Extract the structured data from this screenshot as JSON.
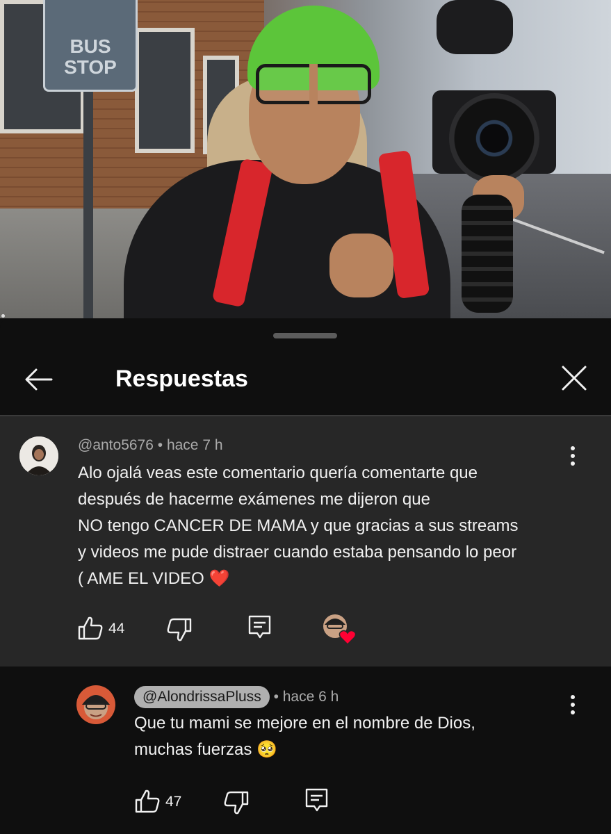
{
  "video": {
    "sign_text_line1": "BUS",
    "sign_text_line2": "STOP"
  },
  "panel": {
    "title": "Respuestas"
  },
  "comment": {
    "author": "@anto5676",
    "time": "hace 7 h",
    "text_lines": [
      "Alo ojalá veas este comentario quería comentarte que",
      "después de hacerme exámenes me dijeron que",
      "NO tengo CANCER DE MAMA y que gracias a sus streams",
      "y videos me pude distraer cuando estaba pensando lo peor",
      "( AME EL VIDEO ❤️"
    ],
    "likes": "44",
    "creator_heart": true
  },
  "reply": {
    "author": "@AlondrissaPluss",
    "time": "hace 6 h",
    "text_lines": [
      "Que tu mami se mejore en el nombre de Dios,",
      "muchas fuerzas 🥺"
    ],
    "likes": "47"
  },
  "colors": {
    "background": "#0f0f0f",
    "comment_bg": "#272727",
    "heart": "#ff0033"
  },
  "icons": [
    "back-arrow-icon",
    "close-icon",
    "like-icon",
    "dislike-icon",
    "reply-icon",
    "more-vert-icon",
    "creator-heart-icon"
  ]
}
